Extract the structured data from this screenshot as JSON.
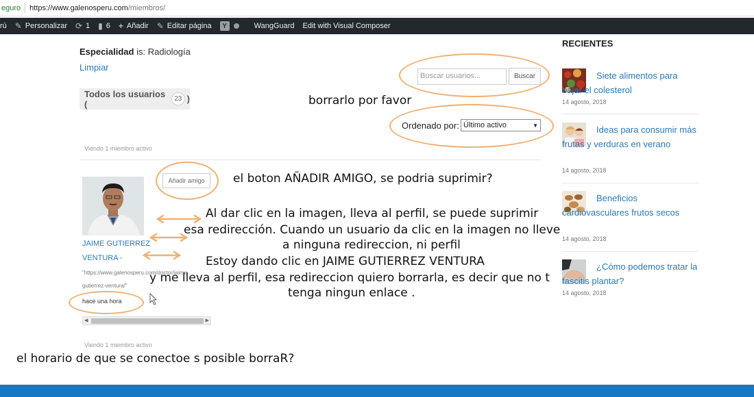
{
  "browser": {
    "secure_label": "eguro",
    "url_host": "https://www.galenosperu.com",
    "url_path": "/miembros/"
  },
  "admin_bar": {
    "site": "rú",
    "customize": "Personalizar",
    "updates_count": "1",
    "comments_count": "6",
    "add_new": "Añadir",
    "edit_page": "Editar página",
    "yoast_glyph": "Y",
    "wangguard": "WangGuard",
    "visual_composer": "Edit with Visual Composer"
  },
  "filter": {
    "label": "Especialidad",
    "value": " is: Radiología",
    "clear": "Limpiar"
  },
  "search": {
    "placeholder": "Buscar usuarios...",
    "button": "Buscar"
  },
  "tabs": {
    "all_label": "Todos los usuarios (",
    "all_count": "23",
    "close_paren": ")"
  },
  "order": {
    "label": "Ordenado por:",
    "selected": "Último activo"
  },
  "viewing_text": "Viendo 1 miembro activo",
  "member": {
    "add_friend": "Añadir amigo",
    "name_line1": "JAIME GUTIERREZ",
    "name_line2": "VENTURA -",
    "url_line1": "\"https://www.galenosperu.com/doctor/jaime",
    "url_line2": "gutierrez-ventura/\"",
    "last_active": "hace una hora"
  },
  "sidebar": {
    "heading": "RECIENTES",
    "posts": [
      {
        "title": "Siete alimentos para bajar el colesterol",
        "date": "14 agosto, 2018"
      },
      {
        "title": "Ideas para consumir más frutas y verduras en verano",
        "date": "14 agosto, 2018"
      },
      {
        "title": "Beneficios cardiovasculares frutos secos",
        "date": "14 agosto, 2018"
      },
      {
        "title": "¿Cómo podemos tratar la fascitis plantar?",
        "date": "14 agosto, 2018"
      }
    ]
  },
  "annotations": {
    "delete_please": "borrarlo por favor",
    "add_friend_question": "el boton AÑADIR AMIGO, se podria suprimir?",
    "image_line1": "Al dar clic en la imagen, lleva al perfil, se puede suprimir",
    "image_line2": "esa redirección. Cuando un usuario da clic en la imagen no lleve",
    "image_line3": "a ninguna redireccion, ni perfil",
    "name_line1": "Estoy dando clic en JAIME GUTIERREZ VENTURA",
    "name_line2": "y me lleva al perfil, esa redireccion quiero borrarla, es decir que no t",
    "name_line3": "tenga ningun enlace .",
    "schedule_question": "el horario de que se conectoe s posible borraR?"
  },
  "colors": {
    "admin_bar": "#23282d",
    "link": "#2a7ab8",
    "annotation_ring": "#f0b070",
    "footer": "#1a78c2"
  }
}
